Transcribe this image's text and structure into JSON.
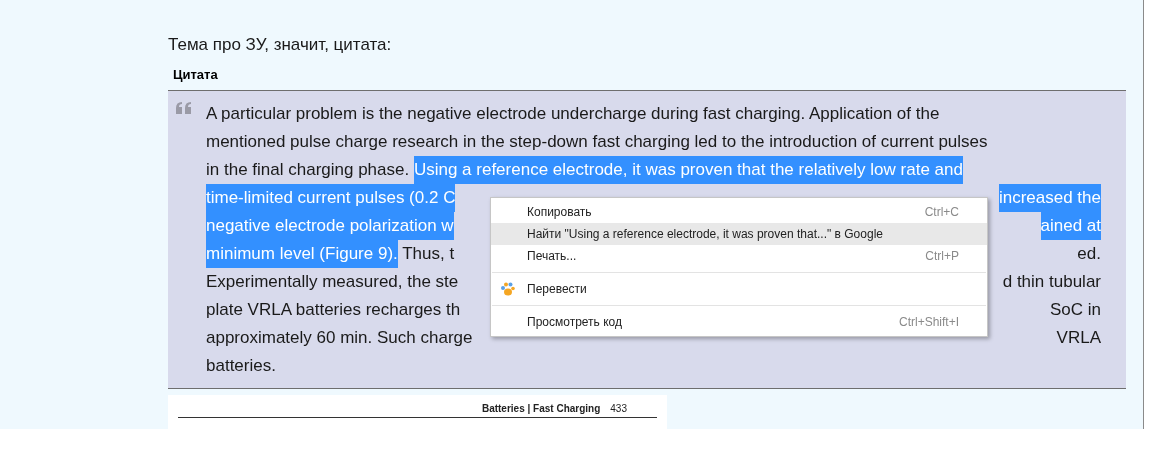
{
  "post": {
    "text": "Тема про ЗУ, значит, цитата:"
  },
  "quote": {
    "title": "Цитата",
    "lines": [
      {
        "left": [
          {
            "text": "A particular problem is the negative electrode undercharge during fast charging. Application of the",
            "selected": false
          }
        ]
      },
      {
        "left": [
          {
            "text": "mentioned pulse charge research in the step-down fast charging led to the introduction of current pulses",
            "selected": false
          }
        ]
      },
      {
        "left": [
          {
            "text": "in the final charging phase. ",
            "selected": false
          },
          {
            "text": "Using a reference electrode, it was proven that the relatively low rate and",
            "selected": true
          }
        ]
      },
      {
        "left": [
          {
            "text": "time-limited current pulses (0.2 C",
            "selected": true
          }
        ],
        "right": [
          {
            "text": "increased the",
            "selected": true
          }
        ]
      },
      {
        "left": [
          {
            "text": "negative electrode polarization w",
            "selected": true
          }
        ],
        "right": [
          {
            "text": "ained at",
            "selected": true
          }
        ]
      },
      {
        "left": [
          {
            "text": "minimum level (Figure 9).",
            "selected": true
          },
          {
            "text": " Thus, t",
            "selected": false
          }
        ],
        "right": [
          {
            "text": "ed.",
            "selected": false
          }
        ]
      },
      {
        "left": [
          {
            "text": "Experimentally measured, the ste",
            "selected": false
          }
        ],
        "right": [
          {
            "text": "d thin tubular",
            "selected": false
          }
        ]
      },
      {
        "left": [
          {
            "text": "plate VRLA batteries recharges th",
            "selected": false
          }
        ],
        "right": [
          {
            "text": "SoC in",
            "selected": false
          }
        ]
      },
      {
        "left": [
          {
            "text": "approximately 60 min. Such charge",
            "selected": false
          }
        ],
        "right": [
          {
            "text": "VRLA",
            "selected": false
          }
        ]
      },
      {
        "left": [
          {
            "text": "batteries.",
            "selected": false
          }
        ]
      }
    ]
  },
  "document_page": {
    "header": "Batteries | Fast Charging",
    "page_number": "433"
  },
  "context_menu": [
    {
      "kind": "item",
      "label": "Копировать",
      "shortcut": "Ctrl+C",
      "selected": false,
      "icon": false
    },
    {
      "kind": "item",
      "label": "Найти \"Using a reference electrode, it was proven that...\" в Google",
      "selected": true,
      "icon": false
    },
    {
      "kind": "item",
      "label": "Печать...",
      "shortcut": "Ctrl+P",
      "selected": false,
      "icon": false
    },
    {
      "kind": "separator"
    },
    {
      "kind": "item",
      "label": "Перевести",
      "selected": false,
      "icon": true
    },
    {
      "kind": "separator"
    },
    {
      "kind": "item",
      "label": "Просмотреть код",
      "shortcut": "Ctrl+Shift+I",
      "selected": false,
      "icon": false
    }
  ]
}
